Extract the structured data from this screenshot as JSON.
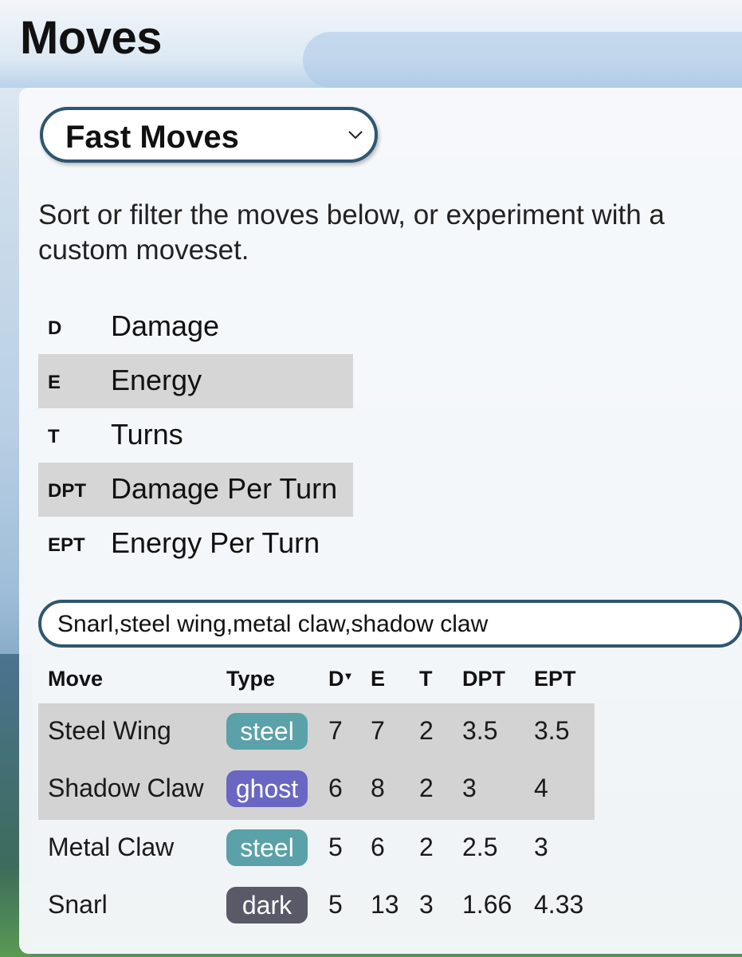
{
  "page": {
    "title": "Moves"
  },
  "move_selector": {
    "selected": "Fast Moves"
  },
  "intro_text": "Sort or filter the moves below, or experiment with a custom moveset.",
  "legend": [
    {
      "abbr": "D",
      "label": "Damage"
    },
    {
      "abbr": "E",
      "label": "Energy"
    },
    {
      "abbr": "T",
      "label": "Turns"
    },
    {
      "abbr": "DPT",
      "label": "Damage Per Turn"
    },
    {
      "abbr": "EPT",
      "label": "Energy Per Turn"
    }
  ],
  "search": {
    "value": "Snarl,steel wing,metal claw,shadow claw"
  },
  "table": {
    "headers": {
      "move": "Move",
      "type": "Type",
      "d": "D",
      "sort_indicator": "▾",
      "e": "E",
      "t": "T",
      "dpt": "DPT",
      "ept": "EPT"
    },
    "rows": [
      {
        "move": "Steel Wing",
        "type": "steel",
        "d": "7",
        "e": "7",
        "t": "2",
        "dpt": "3.5",
        "ept": "3.5"
      },
      {
        "move": "Shadow Claw",
        "type": "ghost",
        "d": "6",
        "e": "8",
        "t": "2",
        "dpt": "3",
        "ept": "4"
      },
      {
        "move": "Metal Claw",
        "type": "steel",
        "d": "5",
        "e": "6",
        "t": "2",
        "dpt": "2.5",
        "ept": "3"
      },
      {
        "move": "Snarl",
        "type": "dark",
        "d": "5",
        "e": "13",
        "t": "3",
        "dpt": "1.66",
        "ept": "4.33"
      }
    ]
  },
  "type_colors": {
    "steel": "#5aa1a9",
    "ghost": "#6a66c4",
    "dark": "#5a5968"
  }
}
